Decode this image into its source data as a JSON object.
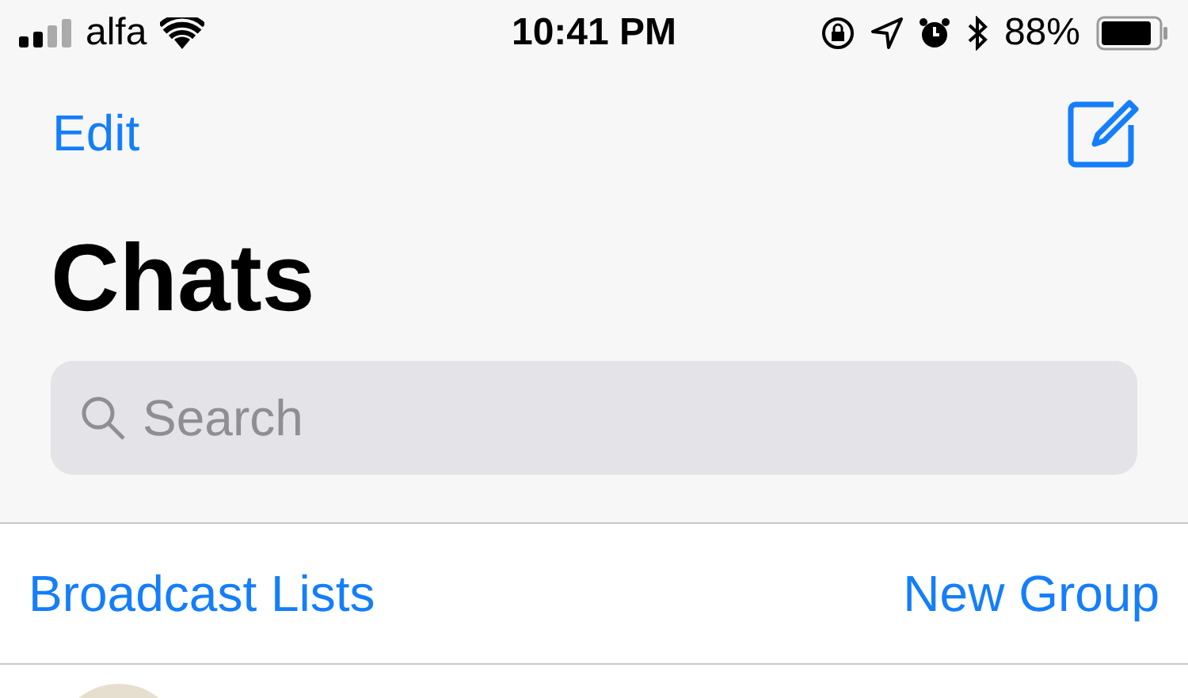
{
  "status_bar": {
    "carrier": "alfa",
    "time": "10:41 PM",
    "battery": "88%"
  },
  "nav": {
    "left": "Edit",
    "title": "Chats"
  },
  "search": {
    "placeholder": "Search"
  },
  "actions": [
    "Broadcast Lists",
    "New Group"
  ]
}
